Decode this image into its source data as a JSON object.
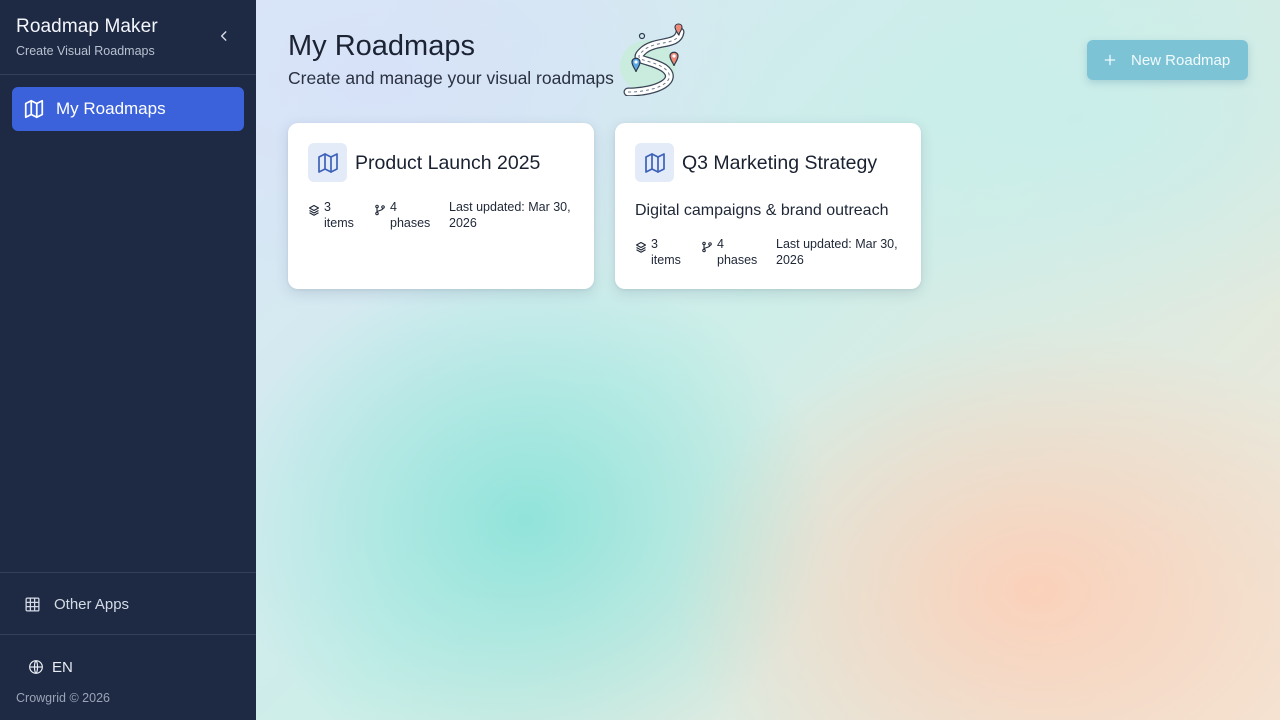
{
  "sidebar": {
    "app_title": "Roadmap Maker",
    "app_subtitle": "Create Visual Roadmaps",
    "nav": [
      {
        "label": "My Roadmaps",
        "icon": "map-icon",
        "active": true
      }
    ],
    "other_apps_label": "Other Apps",
    "language": "EN",
    "copyright": "Crowgrid © 2026"
  },
  "main": {
    "title": "My Roadmaps",
    "subtitle": "Create and manage your visual roadmaps",
    "new_button_label": "New Roadmap",
    "cards": [
      {
        "title": "Product Launch 2025",
        "description": "",
        "items_count": "3",
        "items_label": "items",
        "phases_count": "4",
        "phases_label": "phases",
        "last_updated": "Last updated: Mar 30, 2026"
      },
      {
        "title": "Q3 Marketing Strategy",
        "description": "Digital campaigns & brand outreach",
        "items_count": "3",
        "items_label": "items",
        "phases_count": "4",
        "phases_label": "phases",
        "last_updated": "Last updated: Mar 30, 2026"
      }
    ]
  },
  "colors": {
    "sidebar_bg": "#1e2a44",
    "nav_active": "#3b62db",
    "new_button": "#7cc3d6"
  }
}
